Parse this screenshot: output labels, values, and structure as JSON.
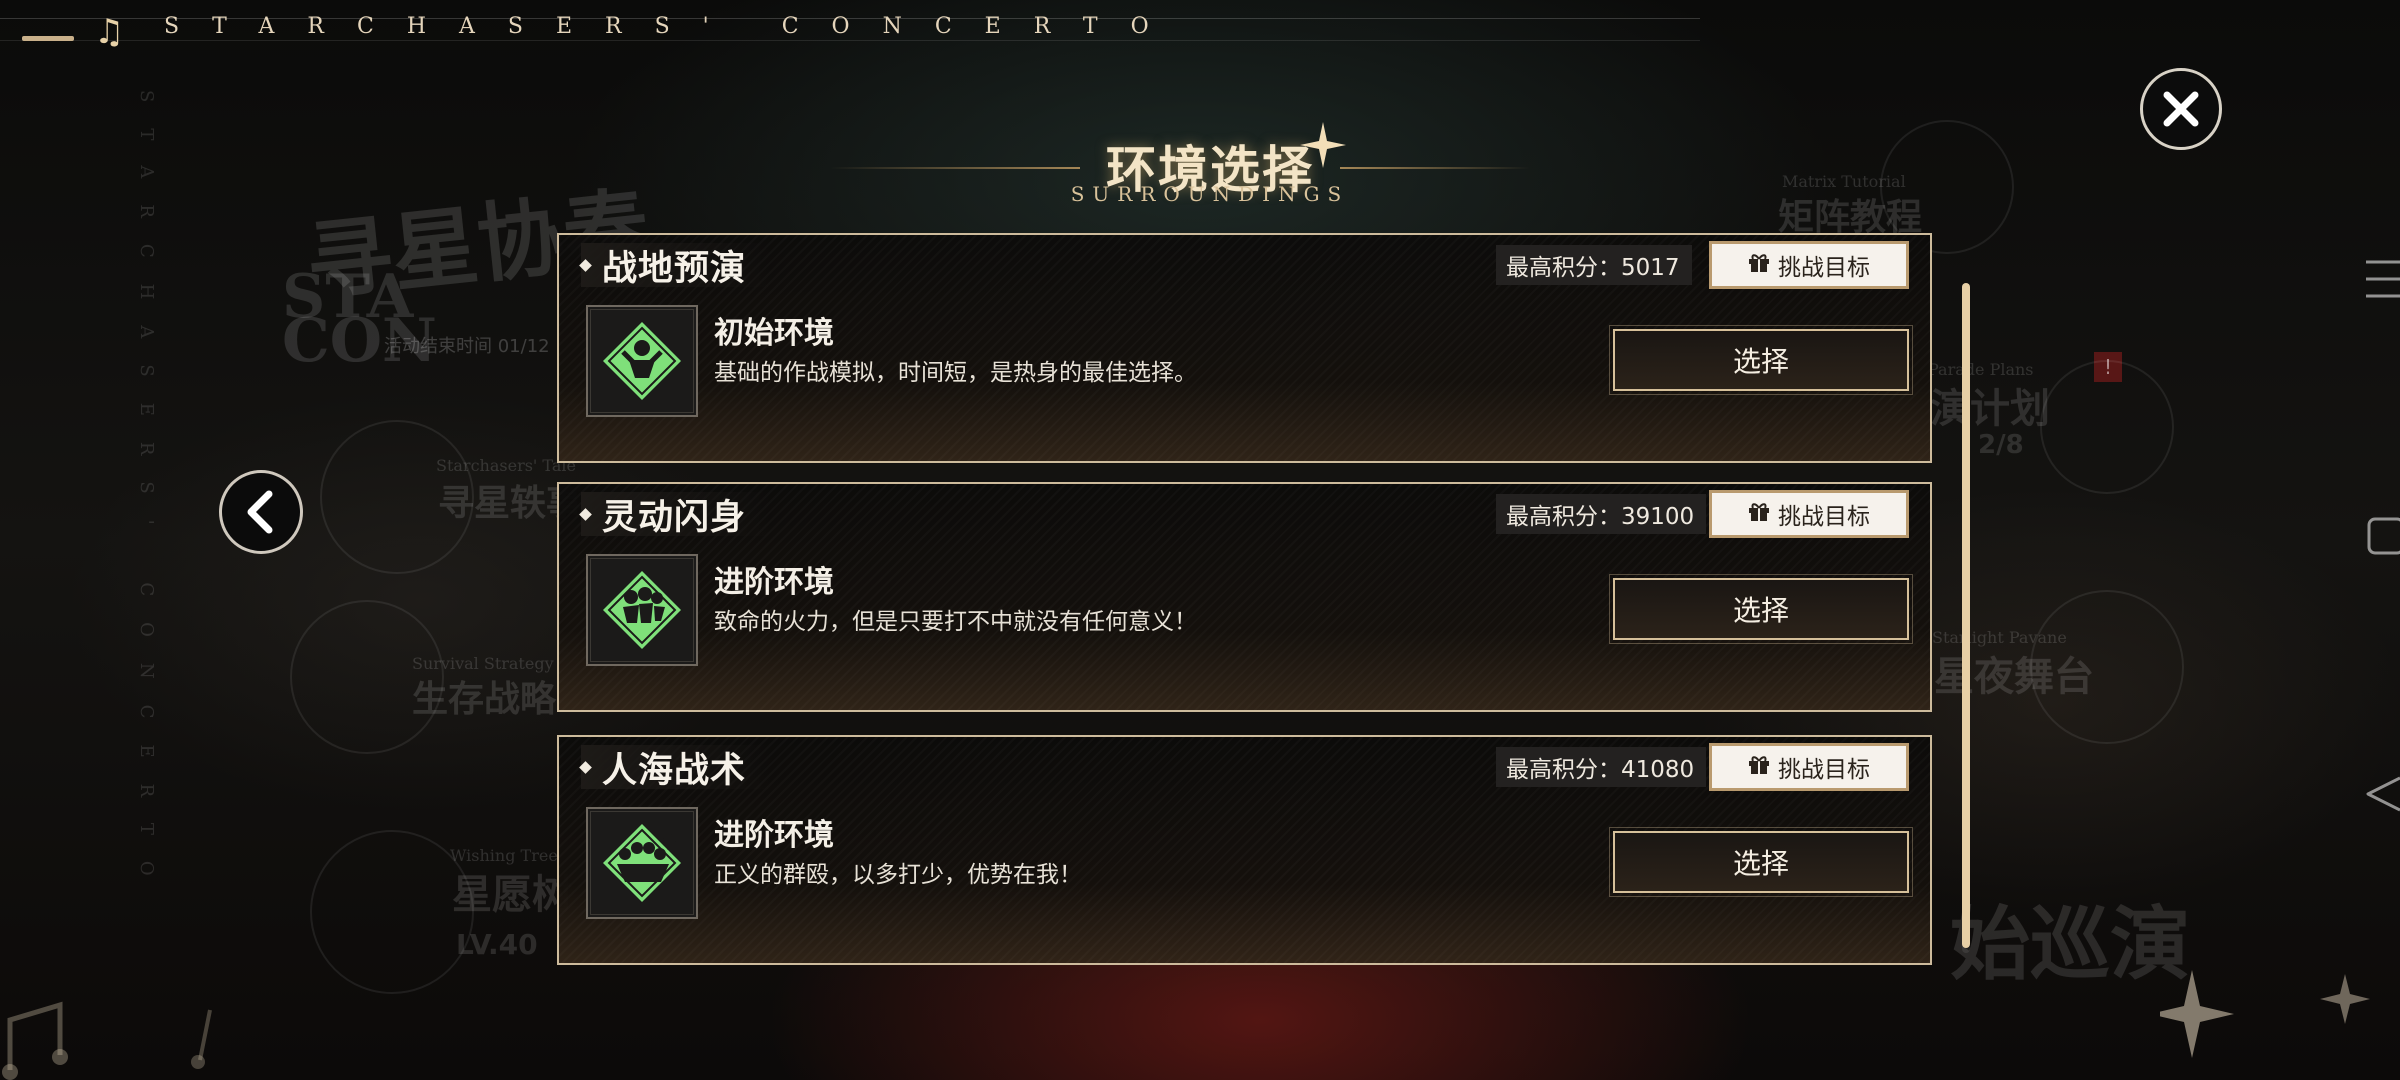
{
  "topbar": {
    "title": "STARCHASERS'  CONCERTO"
  },
  "dialog": {
    "title": "环境选择",
    "subtitle": "SURROUNDINGS"
  },
  "background": {
    "event_title_cn": "寻星协奏",
    "event_title_en_1": "STA",
    "event_title_en_2": "CON",
    "event_time": "活动结束时间 01/12",
    "matrix_en": "Matrix Tutorial",
    "matrix_cn": "矩阵教程",
    "parade_en": "Parade Plans",
    "parade_cn": "演计划",
    "parade_progress": "2/8",
    "tale_en": "Starchasers' Tale",
    "tale_cn": "寻星轶事",
    "survival_en": "Survival Strategy",
    "survival_cn": "生存战略",
    "pavane_en": "Starlight Pavane",
    "pavane_cn": "星夜舞台",
    "wishing_en": "Wishing Tree",
    "wishing_cn": "星愿树",
    "level": "LV.40",
    "tour_cn": "始巡演",
    "vertical_text": "STARCHASERS' CONCERTO"
  },
  "cards": [
    {
      "name": "战地预演",
      "score_label": "最高积分：5017",
      "goal_label": "挑战目标",
      "env_title": "初始环境",
      "env_desc": "基础的作战模拟，时间短，是热身的最佳选择。",
      "select_label": "选择",
      "icon": "single-soldier-emblem-icon"
    },
    {
      "name": "灵动闪身",
      "score_label": "最高积分：39100",
      "goal_label": "挑战目标",
      "env_title": "进阶环境",
      "env_desc": "致命的火力，但是只要打不中就没有任何意义！",
      "select_label": "选择",
      "icon": "dodging-soldiers-emblem-icon"
    },
    {
      "name": "人海战术",
      "score_label": "最高积分：41080",
      "goal_label": "挑战目标",
      "env_title": "进阶环境",
      "env_desc": "正义的群殴，以多打少，优势在我！",
      "select_label": "选择",
      "icon": "crowd-emblem-icon"
    }
  ],
  "colors": {
    "accent": "#e7cfa5",
    "icon_green": "#7fe07a",
    "border": "#cdbb9c"
  }
}
